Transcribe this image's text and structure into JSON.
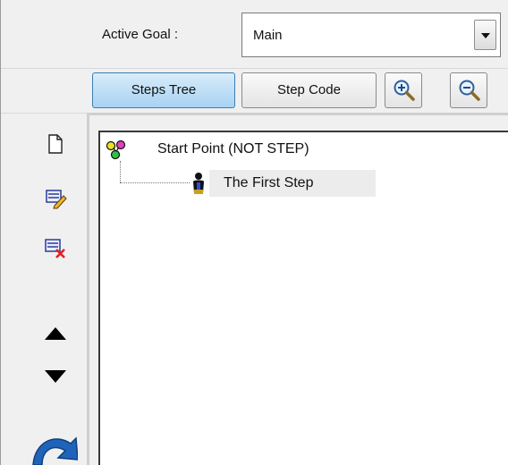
{
  "header": {
    "active_goal_label": "Active Goal :",
    "active_goal_value": "Main"
  },
  "toolbar": {
    "steps_tree_label": "Steps Tree",
    "step_code_label": "Step Code",
    "zoom_in_icon": "zoom-in-icon",
    "zoom_out_icon": "zoom-out-icon"
  },
  "sidebar": {
    "icons": [
      "new-document-icon",
      "edit-step-icon",
      "delete-step-icon",
      "move-up-icon",
      "move-down-icon",
      "undo-icon"
    ]
  },
  "tree": {
    "root_label": "Start Point (NOT STEP)",
    "child_label": "The First Step"
  },
  "colors": {
    "active_tab": "#a8d2f2",
    "delete_mark": "#e02020",
    "selection_bg": "#ececec"
  }
}
